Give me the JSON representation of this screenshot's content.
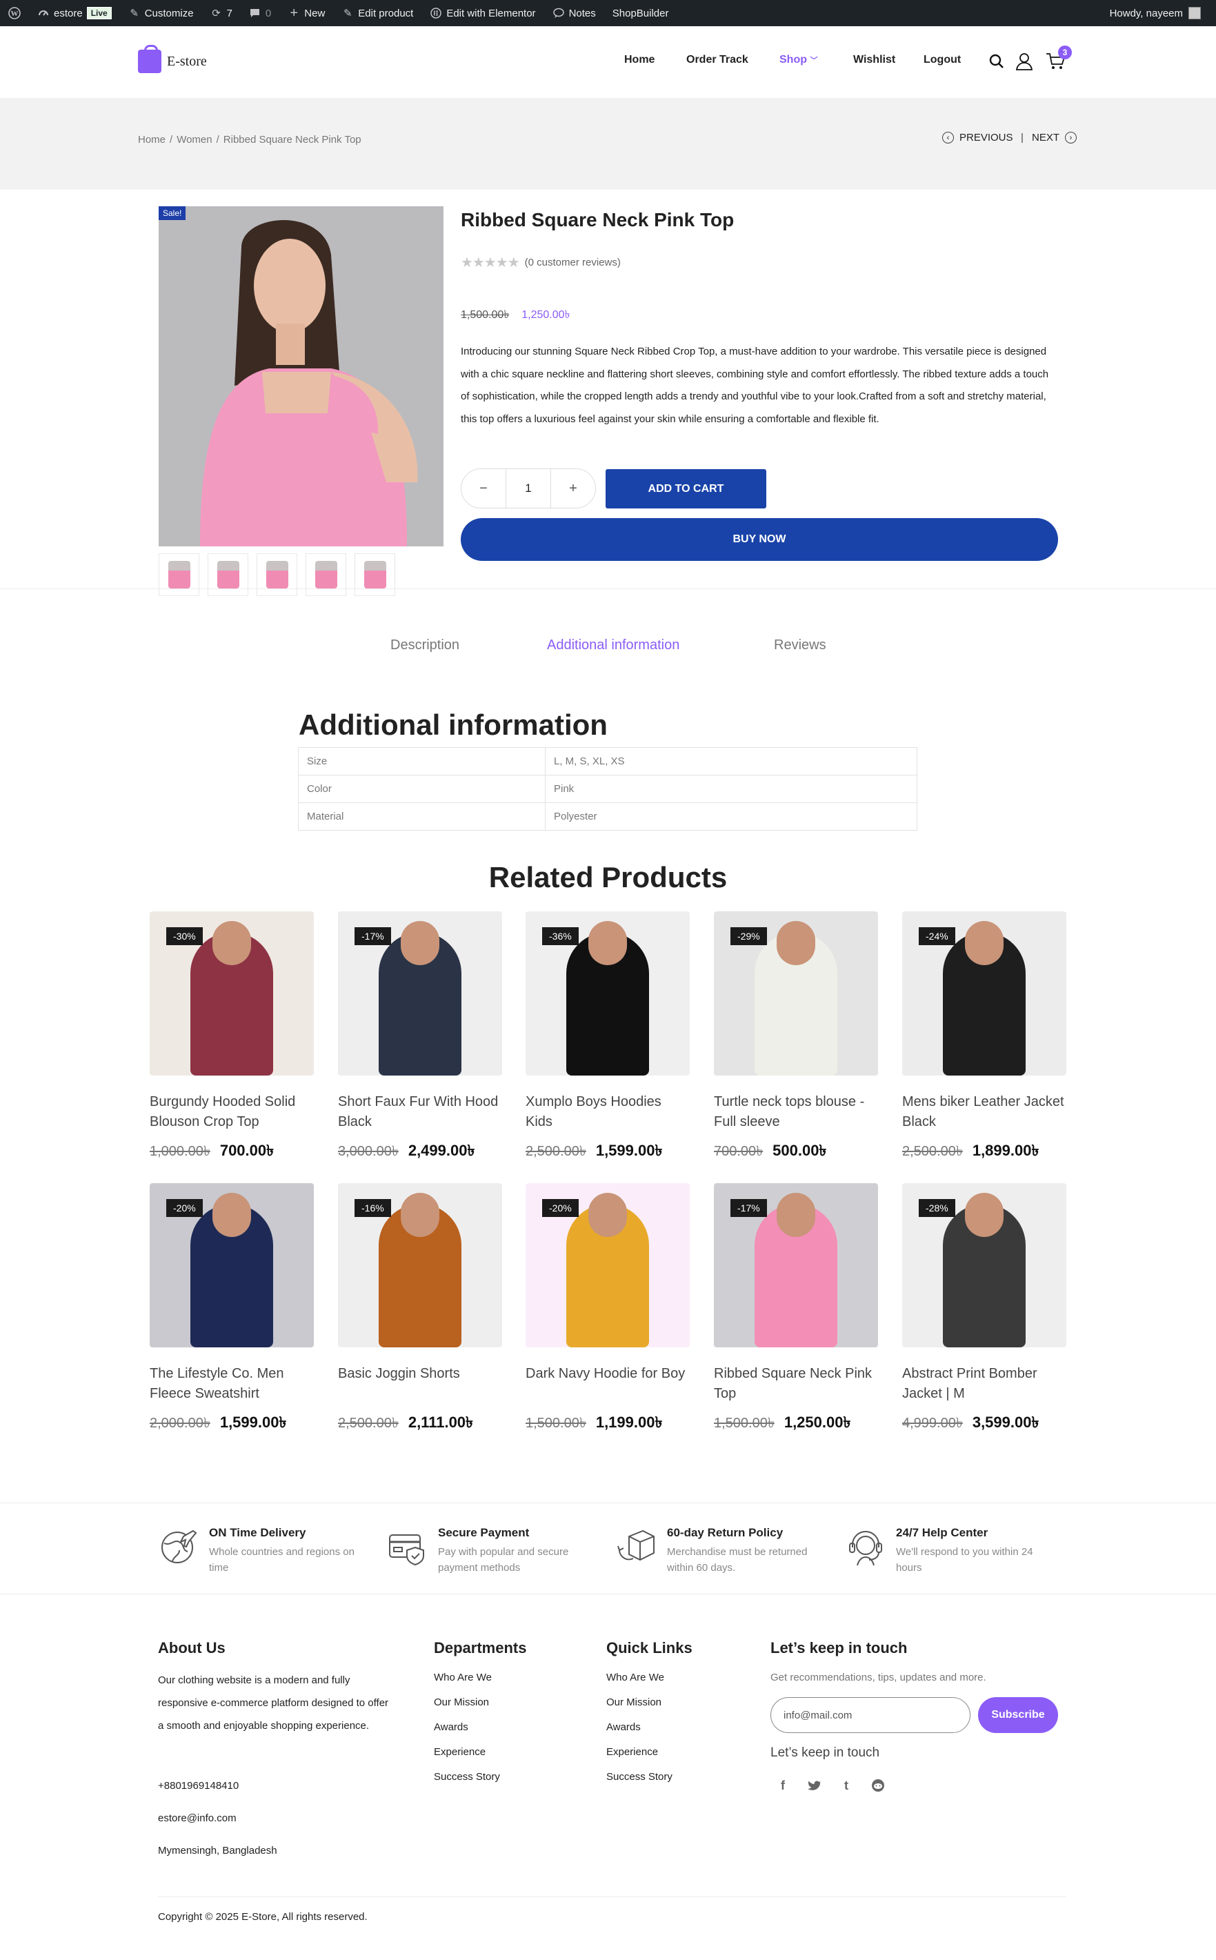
{
  "admin_bar": {
    "site": "estore",
    "live": "Live",
    "customize": "Customize",
    "updates": "7",
    "comments": "0",
    "new": "New",
    "edit_product": "Edit product",
    "edit_elementor": "Edit with Elementor",
    "notes": "Notes",
    "shopbuilder": "ShopBuilder",
    "howdy": "Howdy, nayeem"
  },
  "header": {
    "logo": "E-store",
    "nav": [
      "Home",
      "Order Track",
      "Shop",
      "Wishlist",
      "Logout"
    ],
    "active_nav": "Shop",
    "cart_count": "3"
  },
  "breadcrumb": {
    "items": [
      "Home",
      "Women",
      "Ribbed Square Neck Pink Top"
    ],
    "sep": "/",
    "previous": "PREVIOUS",
    "next": "NEXT",
    "divider": "|"
  },
  "product": {
    "sale_badge": "Sale!",
    "title": "Ribbed Square Neck Pink Top",
    "reviews": "(0 customer reviews)",
    "rating": 0,
    "old_price": "1,500.00৳",
    "price": "1,250.00৳",
    "description": "Introducing our stunning Square Neck Ribbed Crop Top, a must-have addition to your wardrobe. This versatile piece is designed with a chic square neckline and flattering short sleeves, combining style and comfort effortlessly. The ribbed texture adds a touch of sophistication, while the cropped length adds a trendy and youthful vibe to your look.Crafted from a soft and stretchy material, this top offers a luxurious feel against your skin while ensuring a comfortable and flexible fit.",
    "quantity": "1",
    "add_to_cart": "ADD TO CART",
    "buy_now": "BUY NOW",
    "thumbnail_count": 5
  },
  "tabs": {
    "items": [
      "Description",
      "Additional information",
      "Reviews"
    ],
    "active": "Additional information"
  },
  "additional_info": {
    "heading": "Additional information",
    "rows": [
      {
        "label": "Size",
        "value": "L, M, S, XL, XS"
      },
      {
        "label": "Color",
        "value": "Pink"
      },
      {
        "label": "Material",
        "value": "Polyester"
      }
    ]
  },
  "related": {
    "heading": "Related Products",
    "products": [
      {
        "name": "Burgundy Hooded Solid Blouson Crop Top",
        "discount": "-30%",
        "old": "1,000.00৳",
        "price": "700.00৳",
        "color": "#8e3344",
        "bg": "#efe9e4"
      },
      {
        "name": "Short Faux Fur With Hood Black",
        "discount": "-17%",
        "old": "3,000.00৳",
        "price": "2,499.00৳",
        "color": "#2b3446",
        "bg": "#eeeeee"
      },
      {
        "name": "Xumplo Boys Hoodies Kids",
        "discount": "-36%",
        "old": "2,500.00৳",
        "price": "1,599.00৳",
        "color": "#111111",
        "bg": "#efefef"
      },
      {
        "name": "Turtle neck tops blouse - Full sleeve",
        "discount": "-29%",
        "old": "700.00৳",
        "price": "500.00৳",
        "color": "#efefe9",
        "bg": "#e4e4e4"
      },
      {
        "name": "Mens biker Leather Jacket Black",
        "discount": "-24%",
        "old": "2,500.00৳",
        "price": "1,899.00৳",
        "color": "#1e1e1e",
        "bg": "#ececec"
      },
      {
        "name": "The Lifestyle Co. Men Fleece Sweatshirt",
        "discount": "-20%",
        "old": "2,000.00৳",
        "price": "1,599.00৳",
        "color": "#1e2a55",
        "bg": "#c9c9cf"
      },
      {
        "name": "Basic Joggin Shorts",
        "discount": "-16%",
        "old": "2,500.00৳",
        "price": "2,111.00৳",
        "color": "#b9611f",
        "bg": "#eeeeee"
      },
      {
        "name": "Dark Navy Hoodie for Boy",
        "discount": "-20%",
        "old": "1,500.00৳",
        "price": "1,199.00৳",
        "color": "#e8a92a",
        "bg": "#fbeefa"
      },
      {
        "name": "Ribbed Square Neck Pink Top",
        "discount": "-17%",
        "old": "1,500.00৳",
        "price": "1,250.00৳",
        "color": "#f38fb6",
        "bg": "#cfcfd3"
      },
      {
        "name": "Abstract Print Bomber Jacket | M",
        "discount": "-28%",
        "old": "4,999.00৳",
        "price": "3,599.00৳",
        "color": "#3a3a3a",
        "bg": "#eeeeee"
      }
    ]
  },
  "features": [
    {
      "title": "ON Time Delivery",
      "desc": "Whole countries and regions on time",
      "icon": "globe-plane-icon"
    },
    {
      "title": "Secure Payment",
      "desc": "Pay with popular and secure payment methods",
      "icon": "card-shield-icon"
    },
    {
      "title": "60-day Return Policy",
      "desc": "Merchandise must be returned within 60 days.",
      "icon": "return-box-icon"
    },
    {
      "title": "24/7 Help Center",
      "desc": "We'll respond to you within 24 hours",
      "icon": "headset-icon"
    }
  ],
  "footer": {
    "about_heading": "About Us",
    "about_text": "Our clothing website is a modern and fully responsive e-commerce platform designed to offer a smooth and enjoyable shopping experience.",
    "phone": "+8801969148410",
    "email": "estore@info.com",
    "address": "Mymensingh, Bangladesh",
    "departments_heading": "Departments",
    "departments": [
      "Who Are We",
      "Our Mission",
      "Awards",
      "Experience",
      "Success Story"
    ],
    "quicklinks_heading": "Quick Links",
    "quicklinks": [
      "Who Are We",
      "Our Mission",
      "Awards",
      "Experience",
      "Success Story"
    ],
    "touch_heading": "Let’s keep in touch",
    "touch_text": "Get recommendations, tips, updates and more.",
    "email_placeholder": "info@mail.com",
    "subscribe": "Subscribe",
    "touch_sub": "Let’s keep in touch",
    "social": [
      "facebook-icon",
      "twitter-icon",
      "tumblr-icon",
      "reddit-icon"
    ],
    "copyright": "Copyright © 2025 E-Store, All rights reserved."
  }
}
